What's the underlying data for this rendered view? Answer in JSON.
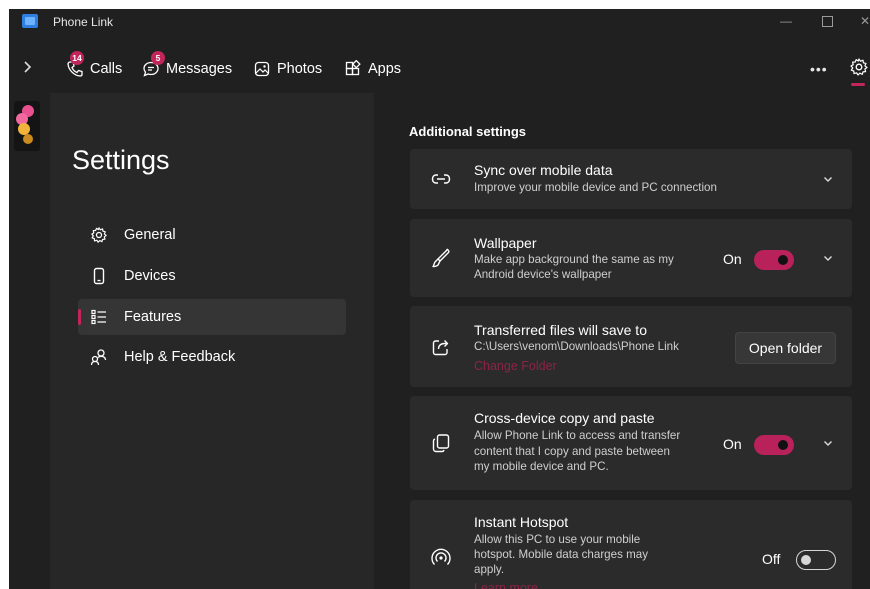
{
  "window": {
    "title": "Phone Link",
    "controls": {
      "minimize": "—",
      "close": "✕"
    }
  },
  "nav": {
    "expand_icon": "chevron-right-icon",
    "tabs": [
      {
        "label": "Calls",
        "icon": "phone-icon",
        "badge": "14"
      },
      {
        "label": "Messages",
        "icon": "message-icon",
        "badge": "5"
      },
      {
        "label": "Photos",
        "icon": "photo-icon"
      },
      {
        "label": "Apps",
        "icon": "apps-icon"
      }
    ],
    "more_label": "•••",
    "settings_icon": "gear-icon"
  },
  "settings": {
    "title": "Settings",
    "menu": [
      {
        "label": "General",
        "icon": "gear-icon"
      },
      {
        "label": "Devices",
        "icon": "phone-device-icon"
      },
      {
        "label": "Features",
        "icon": "features-list-icon",
        "selected": true
      },
      {
        "label": "Help & Feedback",
        "icon": "people-feedback-icon"
      }
    ]
  },
  "content": {
    "section_header": "Additional settings",
    "cards": {
      "sync": {
        "title": "Sync over mobile data",
        "desc": "Improve your mobile device and PC connection",
        "icon": "link-icon"
      },
      "wallpaper": {
        "title": "Wallpaper",
        "desc1": "Make app background the same as my",
        "desc2": "Android device's wallpaper",
        "toggle_label": "On",
        "toggle_state": true,
        "icon": "brush-icon"
      },
      "transfer": {
        "title": "Transferred files will save to",
        "path": "C:\\Users\\venom\\Downloads\\Phone Link",
        "link": "Change Folder",
        "button": "Open folder",
        "icon": "share-icon"
      },
      "copy": {
        "title": "Cross-device copy and paste",
        "desc1": "Allow Phone Link to access and transfer",
        "desc2": "content that I copy and paste between",
        "desc3": "my mobile device and PC.",
        "toggle_label": "On",
        "toggle_state": true,
        "icon": "copy-icon"
      },
      "hotspot": {
        "title": "Instant Hotspot",
        "desc1": "Allow this PC to use your mobile",
        "desc2": "hotspot. Mobile data charges may",
        "desc3": "apply.",
        "link": "Learn more",
        "toggle_label": "Off",
        "toggle_state": false,
        "icon": "hotspot-icon"
      }
    }
  },
  "colors": {
    "accent": "#c2255c",
    "background": "#202020",
    "panel": "#272727",
    "card": "#2b2b2b"
  }
}
